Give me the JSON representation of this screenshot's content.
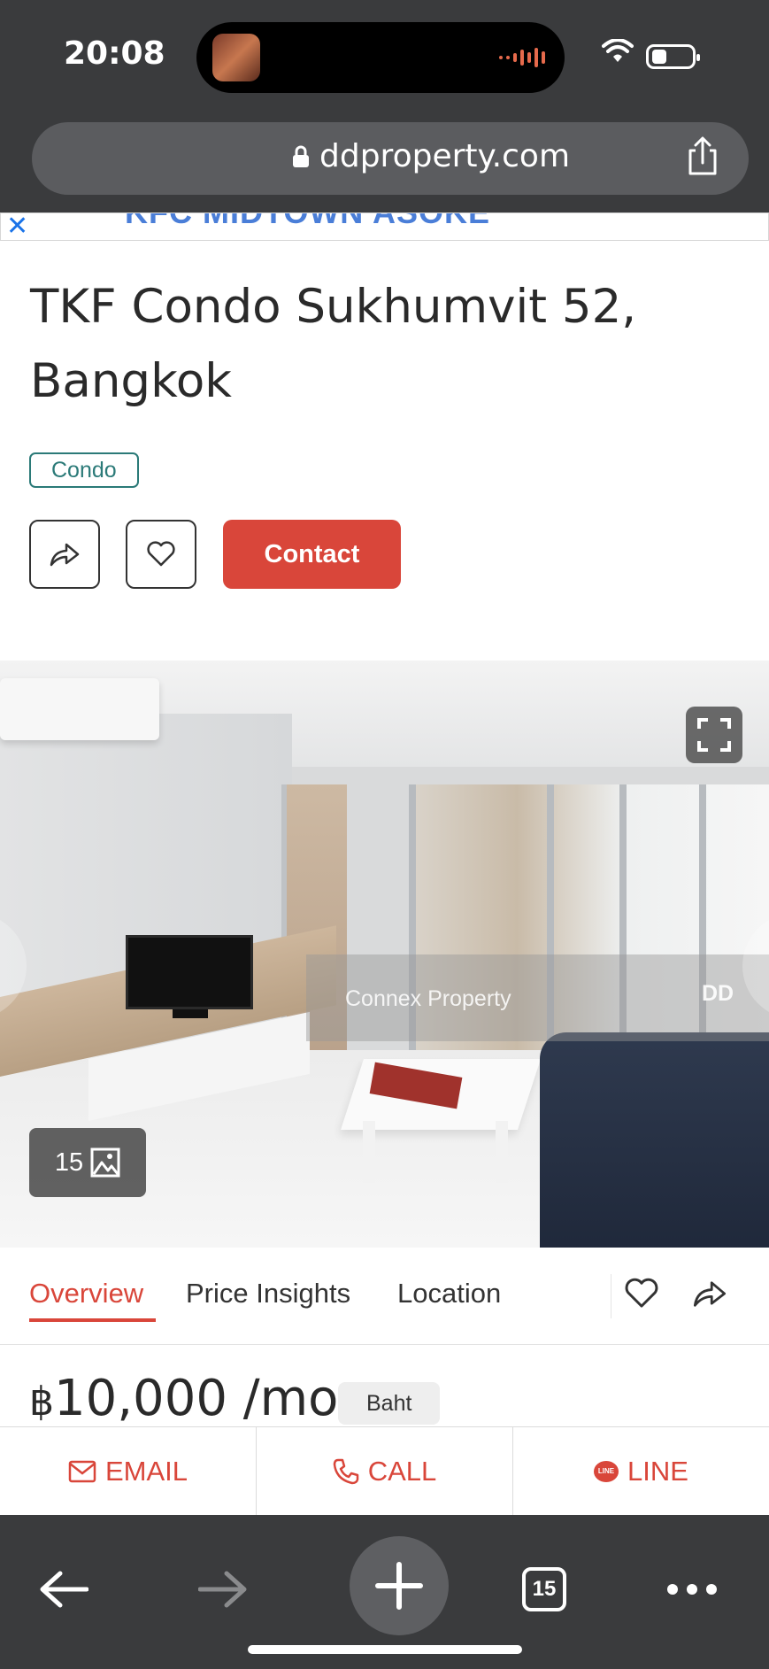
{
  "status_bar": {
    "time": "20:08"
  },
  "browser": {
    "url": "ddproperty.com",
    "tab_count": "15"
  },
  "ad": {
    "text": "KFC MIDTOWN ASOKE"
  },
  "listing": {
    "title": "TKF Condo Sukhumvit 52, Bangkok",
    "type_tag": "Condo",
    "contact_label": "Contact",
    "photo_count": "15",
    "watermark": "Connex Property",
    "watermark_logo": "DD"
  },
  "tabs": [
    {
      "label": "Overview",
      "active": true
    },
    {
      "label": "Price Insights",
      "active": false
    },
    {
      "label": "Location",
      "active": false
    }
  ],
  "price": {
    "symbol": "฿",
    "amount": "10,000 /mo",
    "currency": "Baht"
  },
  "actions": [
    {
      "label": "EMAIL",
      "icon": "mail-icon"
    },
    {
      "label": "CALL",
      "icon": "phone-icon"
    },
    {
      "label": "LINE",
      "icon": "line-chat-icon",
      "badge": "LINE"
    }
  ],
  "colors": {
    "accent": "#d9463a",
    "tag": "#2b7a78",
    "chrome": "#3a3b3d"
  }
}
